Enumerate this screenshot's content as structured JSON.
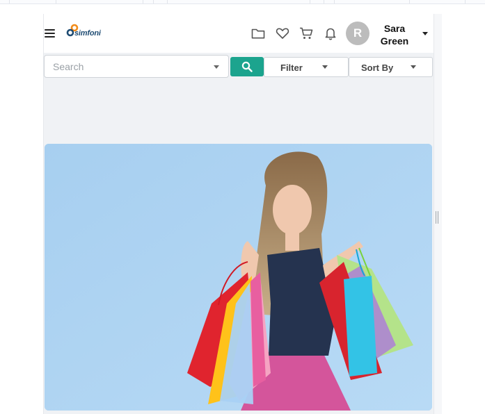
{
  "app": {
    "logo_text": "simfoni"
  },
  "header": {
    "icons": [
      "menu-icon",
      "folder-icon",
      "heart-icon",
      "cart-icon",
      "bell-icon",
      "chevron-down-icon"
    ],
    "user": {
      "initial": "R",
      "first_name": "Sara",
      "last_name": "Green"
    }
  },
  "toolbar": {
    "search": {
      "placeholder": "Search",
      "value": ""
    },
    "filter_label": "Filter",
    "sort_label": "Sort By"
  },
  "banner": {
    "subject": "woman holding colorful shopping bags"
  },
  "colors": {
    "accent": "#1ca48e",
    "logo_text": "#1f4c73",
    "logo_orange": "#f28c1b",
    "avatar": "#bcbcbc",
    "page_bg": "#f0f2f5"
  }
}
